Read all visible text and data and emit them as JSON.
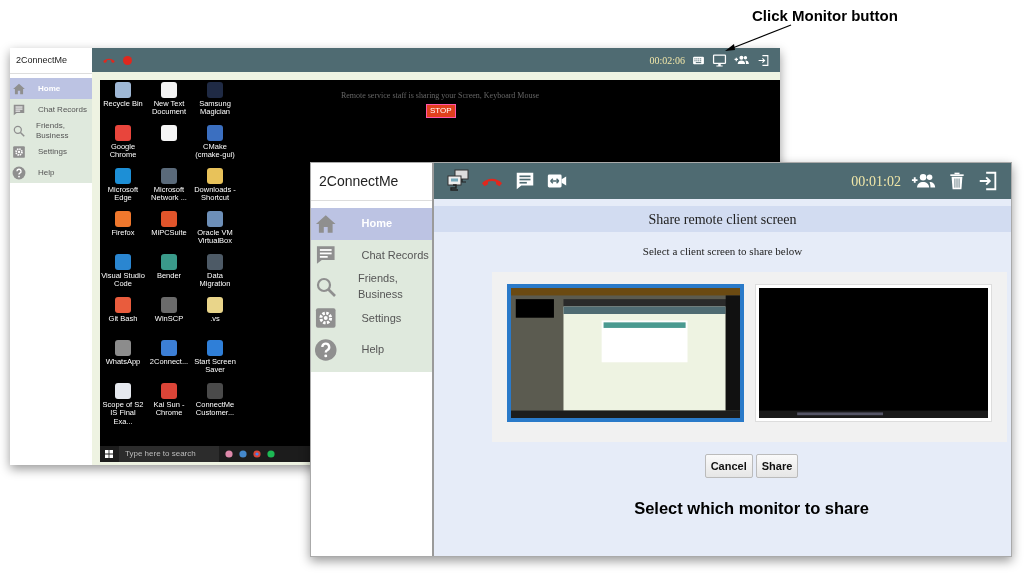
{
  "annotations": [
    "Click Monitor button",
    "Select which monitor to share"
  ],
  "back_window": {
    "title": "2ConnectMe",
    "nav": [
      {
        "label": "Home",
        "kind": "home",
        "selected": true
      },
      {
        "label": "Chat Records",
        "kind": "chat",
        "selected": false
      },
      {
        "label": "Friends, Business",
        "kind": "search",
        "selected": false
      },
      {
        "label": "Settings",
        "kind": "gear",
        "selected": false
      },
      {
        "label": "Help",
        "kind": "help",
        "selected": false
      }
    ],
    "call_timer": "00:02:06",
    "desktop": {
      "banner": "Remote service staff is sharing your Screen, Keyboard Mouse",
      "stop_button": "STOP",
      "icons": [
        {
          "label": "Recycle Bin",
          "color": "#9fb8d6"
        },
        {
          "label": "New Text Document",
          "color": "#f2f2f2"
        },
        {
          "label": "Samsung Magician",
          "color": "#1f2a44"
        },
        {
          "label": "Google Chrome",
          "color": "#e8453c"
        },
        {
          "color": "#f5f5f5"
        },
        {
          "label": "CMake (cmake-gui)",
          "color": "#3b6fc0"
        },
        {
          "label": "Microsoft Edge",
          "color": "#1d8fd6"
        },
        {
          "label": "Microsoft Network ...",
          "color": "#5a6a7a"
        },
        {
          "label": "Downloads - Shortcut",
          "color": "#e8c25a"
        },
        {
          "label": "Firefox",
          "color": "#f0782d"
        },
        {
          "label": "MiPCSuite",
          "color": "#e2552b"
        },
        {
          "label": "Oracle VM VirtualBox",
          "color": "#6d8fb8"
        },
        {
          "label": "Visual Studio Code",
          "color": "#2a86d1"
        },
        {
          "label": "Bender",
          "color": "#3a9a8a"
        },
        {
          "label": "Data Migration",
          "color": "#4d5a66"
        },
        {
          "label": "Git Bash",
          "color": "#e95c3d"
        },
        {
          "label": "WinSCP",
          "color": "#6b6b6b"
        },
        {
          "label": ".vs",
          "color": "#e9d58a"
        },
        {
          "label": "WhatsApp",
          "color": "#8c8c8c"
        },
        {
          "label": "2Connect...",
          "color": "#3c7fd6"
        },
        {
          "label": "Start Screen Saver",
          "color": "#2f7fd8"
        },
        {
          "label": "Scope of S2 IS Final Exa...",
          "color": "#e6e9ef"
        },
        {
          "label": "Kai Sun - Chrome",
          "color": "#db4437"
        },
        {
          "label": "ConnectMe Customer...",
          "color": "#4a4a4a"
        }
      ],
      "taskbar_search": "Type here to search"
    }
  },
  "front_window": {
    "title": "2ConnectMe",
    "nav": [
      {
        "label": "Home",
        "kind": "home",
        "selected": true
      },
      {
        "label": "Chat Records",
        "kind": "chat",
        "selected": false
      },
      {
        "label": "Friends, Business",
        "kind": "search",
        "selected": false
      },
      {
        "label": "Settings",
        "kind": "gear",
        "selected": false
      },
      {
        "label": "Help",
        "kind": "help",
        "selected": false
      }
    ],
    "call_timer": "00:01:02",
    "dialog": {
      "title": "Share remote client screen",
      "subtitle": "Select a client screen to share below",
      "screens": [
        {
          "kind": "picture",
          "selected": true
        },
        {
          "kind": "picture",
          "selected": false
        }
      ],
      "buttons": [
        "Cancel",
        "Share"
      ]
    }
  }
}
